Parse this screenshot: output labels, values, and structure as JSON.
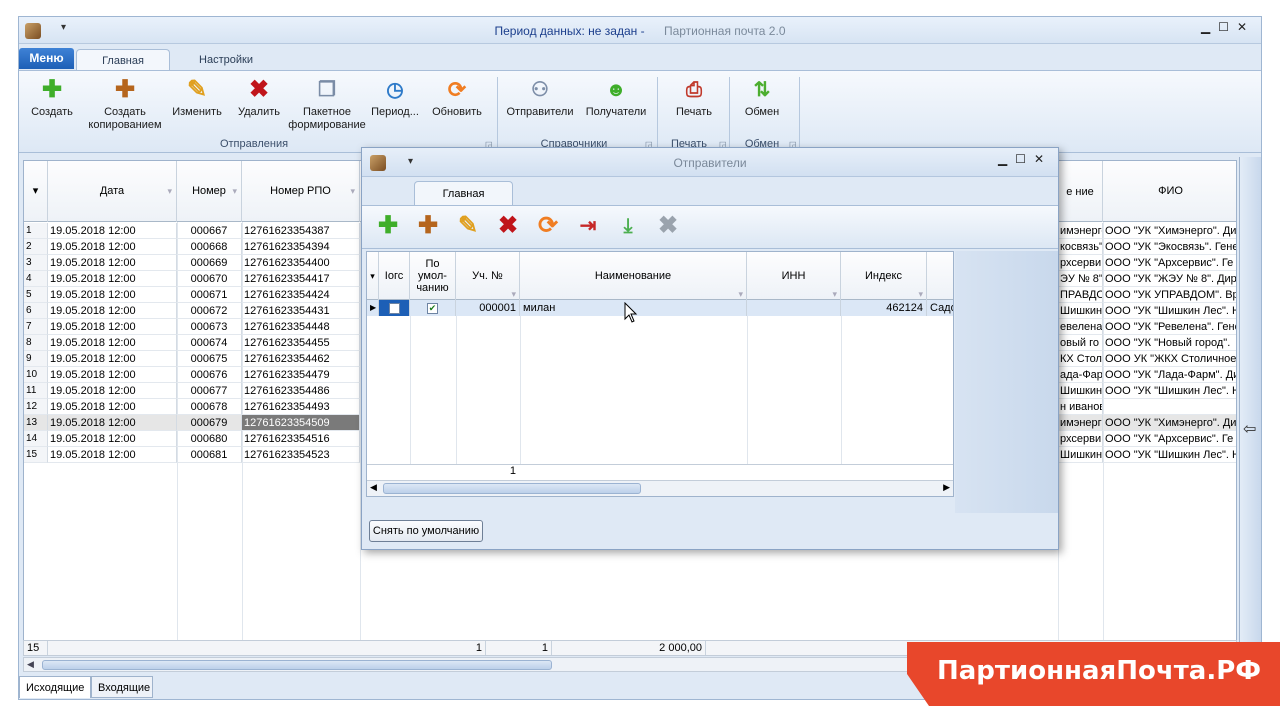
{
  "titlebar": {
    "period": "Период данных: не задан -",
    "app_name": "Партионная почта 2.0"
  },
  "main_tabs": {
    "menu": "Меню",
    "home": "Главная",
    "settings": "Настройки"
  },
  "ribbon": {
    "create": "Создать",
    "copy_create": "Создать копированием",
    "edit": "Изменить",
    "delete": "Удалить",
    "batch": "Пакетное формирование",
    "period": "Период...",
    "refresh": "Обновить",
    "group_send": "Отправления",
    "senders": "Отправители",
    "receivers": "Получатели",
    "group_ref": "Справочники",
    "print": "Печать",
    "group_print": "Печать",
    "exchange": "Обмен",
    "group_exchange": "Обмен"
  },
  "grid": {
    "headers": {
      "date": "Дата",
      "number": "Номер",
      "rpo": "Номер РПО",
      "fio": "ФИО",
      "name_partial": "е ние"
    },
    "rows": [
      {
        "n": "1",
        "date": "19.05.2018 12:00",
        "num": "000667",
        "rpo": "12761623354387",
        "org": "имэнерго",
        "fio": "ООО \"УК \"Химэнерго\". Ди"
      },
      {
        "n": "2",
        "date": "19.05.2018 12:00",
        "num": "000668",
        "rpo": "12761623354394",
        "org": "косвязь\"",
        "fio": "ООО \"УК \"Экосвязь\". Гене"
      },
      {
        "n": "3",
        "date": "19.05.2018 12:00",
        "num": "000669",
        "rpo": "12761623354400",
        "org": "рхсерви",
        "fio": "ООО \"УК \"Архсервис\". Ге"
      },
      {
        "n": "4",
        "date": "19.05.2018 12:00",
        "num": "000670",
        "rpo": "12761623354417",
        "org": "ЭУ № 8\"",
        "fio": "ООО \"УК \"ЖЭУ № 8\". Дир"
      },
      {
        "n": "5",
        "date": "19.05.2018 12:00",
        "num": "000671",
        "rpo": "12761623354424",
        "org": "ПРАВДО",
        "fio": "ООО \"УК УПРАВДОМ\". Вр"
      },
      {
        "n": "6",
        "date": "19.05.2018 12:00",
        "num": "000672",
        "rpo": "12761623354431",
        "org": "Шишкин",
        "fio": "ООО \"УК \"Шишкин Лес\". Н"
      },
      {
        "n": "7",
        "date": "19.05.2018 12:00",
        "num": "000673",
        "rpo": "12761623354448",
        "org": "евелена",
        "fio": "ООО \"УК \"Ревелена\". Гене"
      },
      {
        "n": "8",
        "date": "19.05.2018 12:00",
        "num": "000674",
        "rpo": "12761623354455",
        "org": "овый го",
        "fio": "ООО \"УК \"Новый город\"."
      },
      {
        "n": "9",
        "date": "19.05.2018 12:00",
        "num": "000675",
        "rpo": "12761623354462",
        "org": "КХ Стол",
        "fio": "ООО УК \"ЖКХ Столичное"
      },
      {
        "n": "10",
        "date": "19.05.2018 12:00",
        "num": "000676",
        "rpo": "12761623354479",
        "org": "ада-Фар",
        "fio": "ООО \"УК \"Лада-Фарм\". Ди"
      },
      {
        "n": "11",
        "date": "19.05.2018 12:00",
        "num": "000677",
        "rpo": "12761623354486",
        "org": "Шишкин .",
        "fio": "ООО \"УК \"Шишкин Лес\". Н"
      },
      {
        "n": "12",
        "date": "19.05.2018 12:00",
        "num": "000678",
        "rpo": "12761623354493",
        "org": "н иванов",
        "fio": ""
      },
      {
        "n": "13",
        "date": "19.05.2018 12:00",
        "num": "000679",
        "rpo": "12761623354509",
        "org": "имэнерг",
        "fio": "ООО \"УК \"Химэнерго\". Ди"
      },
      {
        "n": "14",
        "date": "19.05.2018 12:00",
        "num": "000680",
        "rpo": "12761623354516",
        "org": "рхсерви",
        "fio": "ООО \"УК \"Архсервис\". Ге"
      },
      {
        "n": "15",
        "date": "19.05.2018 12:00",
        "num": "000681",
        "rpo": "12761623354523",
        "org": "Шишкин .",
        "fio": "ООО \"УК \"Шишкин Лес\". Н"
      }
    ],
    "footer": {
      "count": "15",
      "v1": "1",
      "v2": "1",
      "sum": "2 000,00"
    }
  },
  "bottom_tabs": {
    "outgoing": "Исходящие",
    "incoming": "Входящие"
  },
  "dialog": {
    "title": "Отправители",
    "tab": "Главная",
    "headers": {
      "c0": "Іогс",
      "c1": "По умол-чанию",
      "c2": "Уч. №",
      "c3": "Наименование",
      "c4": "ИНН",
      "c5": "Индекс"
    },
    "row": {
      "num": "000001",
      "name": "милан",
      "inn": "",
      "index": "462124",
      "addr": "Садо"
    },
    "footer_count": "1",
    "unset_button": "Снять по умолчанию"
  },
  "banner": {
    "text": "ПартионнаяПочта.РФ",
    "color": "#e8472b"
  }
}
